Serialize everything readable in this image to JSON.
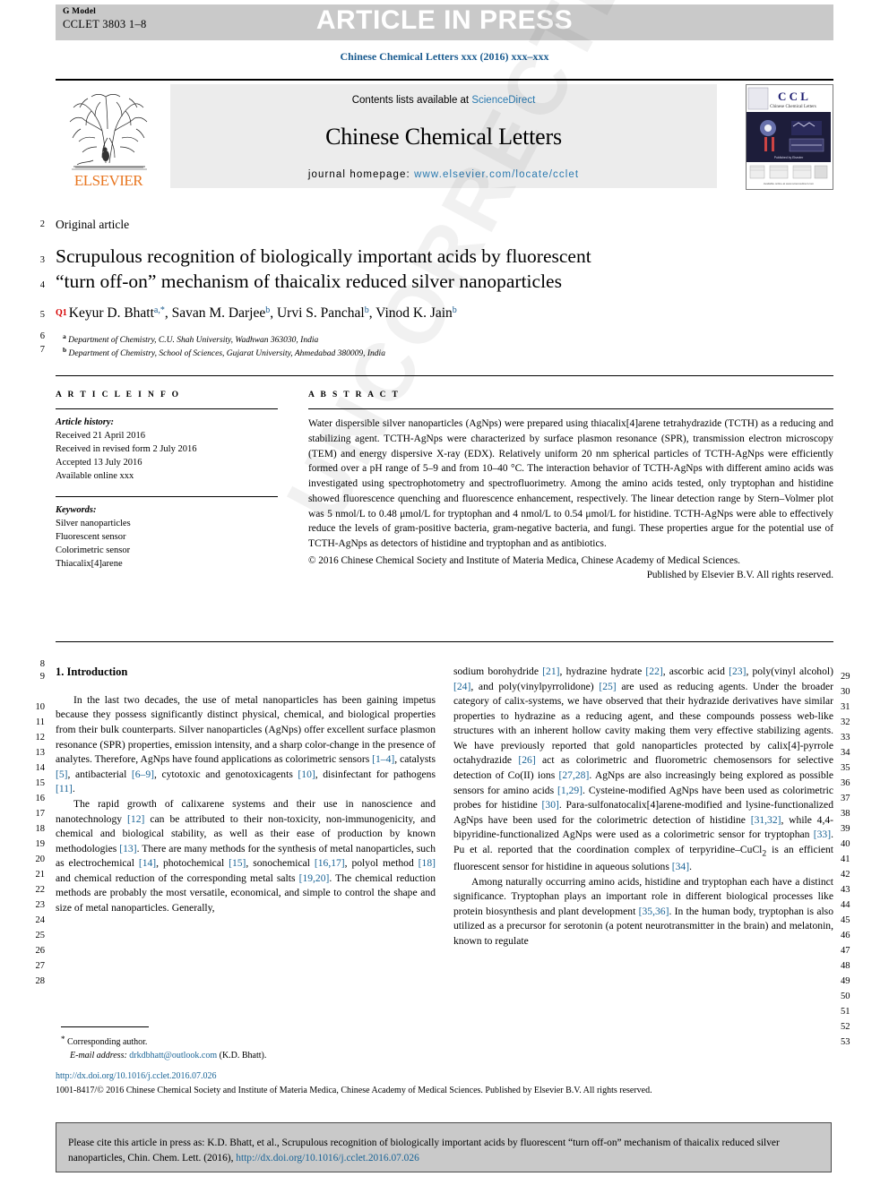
{
  "banner": {
    "g_model_label": "G Model",
    "g_model_code": "CCLET 3803 1–8",
    "article_in_press": "ARTICLE IN PRESS"
  },
  "journal_ref_line": "Chinese Chemical Letters xxx (2016) xxx–xxx",
  "masthead": {
    "contents_prefix": "Contents lists available at ",
    "contents_link": "ScienceDirect",
    "journal_title": "Chinese Chemical Letters",
    "homepage_label": "journal homepage: ",
    "homepage_url": "www.elsevier.com/locate/cclet",
    "publisher": "ELSEVIER",
    "cover_title": "C C L",
    "cover_subtitle": "Chinese Chemical Letters"
  },
  "article": {
    "type_label": "Original article",
    "title_line1": "Scrupulous recognition of biologically important acids by fluorescent",
    "title_line2": "“turn off-on” mechanism of thaicalix reduced silver nanoparticles",
    "query_marker": "Q1",
    "authors_html": "Keyur D. Bhatt, Savan M. Darjee, Urvi S. Panchal, Vinod K. Jain",
    "affiliation_a": "Department of Chemistry, C.U. Shah University, Wadhwan 363030, India",
    "affiliation_b": "Department of Chemistry, School of Sciences, Gujarat University, Ahmedabad 380009, India"
  },
  "article_info": {
    "heading": "A R T I C L E  I N F O",
    "history_label": "Article history:",
    "history": [
      "Received 21 April 2016",
      "Received in revised form 2 July 2016",
      "Accepted 13 July 2016",
      "Available online xxx"
    ],
    "keywords_label": "Keywords:",
    "keywords": [
      "Silver nanoparticles",
      "Fluorescent sensor",
      "Colorimetric sensor",
      "Thiacalix[4]arene"
    ]
  },
  "abstract": {
    "heading": "A B S T R A C T",
    "text": "Water dispersible silver nanoparticles (AgNps) were prepared using thiacalix[4]arene tetrahydrazide (TCTH) as a reducing and stabilizing agent. TCTH-AgNps were characterized by surface plasmon resonance (SPR), transmission electron microscopy (TEM) and energy dispersive X-ray (EDX). Relatively uniform 20 nm spherical particles of TCTH-AgNps were efficiently formed over a pH range of 5–9 and from 10–40 °C. The interaction behavior of TCTH-AgNps with different amino acids was investigated using spectrophotometry and spectrofluorimetry. Among the amino acids tested, only tryptophan and histidine showed fluorescence quenching and fluorescence enhancement, respectively. The linear detection range by Stern–Volmer plot was 5 nmol/L to 0.48 μmol/L for tryptophan and 4 nmol/L to 0.54 μmol/L for histidine. TCTH-AgNps were able to effectively reduce the levels of gram-positive bacteria, gram-negative bacteria, and fungi. These properties argue for the potential use of TCTH-AgNps as detectors of histidine and tryptophan and as antibiotics.",
    "copyright_line1": "© 2016 Chinese Chemical Society and Institute of Materia Medica, Chinese Academy of Medical Sciences.",
    "copyright_line2": "Published by Elsevier B.V. All rights reserved."
  },
  "body": {
    "section_heading": "1. Introduction",
    "left_paragraphs": [
      "In the last two decades, the use of metal nanoparticles has been gaining impetus because they possess significantly distinct physical, chemical, and biological properties from their bulk counterparts. Silver nanoparticles (AgNps) offer excellent surface plasmon resonance (SPR) properties, emission intensity, and a sharp color-change in the presence of analytes. Therefore, AgNps have found applications as colorimetric sensors [1–4], catalysts [5], antibacterial [6–9], cytotoxic and genotoxicagents [10], disinfectant for pathogens [11].",
      "The rapid growth of calixarene systems and their use in nanoscience and nanotechnology [12] can be attributed to their non-toxicity, non-immunogenicity, and chemical and biological stability, as well as their ease of production by known methodologies [13]. There are many methods for the synthesis of metal nanoparticles, such as electrochemical [14], photochemical [15], sonochemical [16,17], polyol method [18] and chemical reduction of the corresponding metal salts [19,20]. The chemical reduction methods are probably the most versatile, economical, and simple to control the shape and size of metal nanoparticles. Generally,"
    ],
    "right_paragraphs": [
      "sodium borohydride [21], hydrazine hydrate [22], ascorbic acid [23], poly(vinyl alcohol) [24], and poly(vinylpyrrolidone) [25] are used as reducing agents. Under the broader category of calix-systems, we have observed that their hydrazide derivatives have similar properties to hydrazine as a reducing agent, and these compounds possess web-like structures with an inherent hollow cavity making them very effective stabilizing agents. We have previously reported that gold nanoparticles protected by calix[4]-pyrrole octahydrazide [26] act as colorimetric and fluorometric chemosensors for selective detection of Co(II) ions [27,28]. AgNps are also increasingly being explored as possible sensors for amino acids [1,29]. Cysteine-modified AgNps have been used as colorimetric probes for histidine [30]. Para-sulfonatocalix[4]arene-modified and lysine-functionalized AgNps have been used for the colorimetric detection of histidine [31,32], while 4,4-bipyridine-functionalized AgNps were used as a colorimetric sensor for tryptophan [33]. Pu et al. reported that the coordination complex of terpyridine–CuCl2 is an efficient fluorescent sensor for histidine in aqueous solutions [34].",
      "Among naturally occurring amino acids, histidine and tryptophan each have a distinct significance. Tryptophan plays an important role in different biological processes like protein biosynthesis and plant development [35,36]. In the human body, tryptophan is also utilized as a precursor for serotonin (a potent neurotransmitter in the brain) and melatonin, known to regulate"
    ]
  },
  "footnotes": {
    "corresponding_author": "Corresponding author.",
    "email_label": "E-mail address:",
    "email": "drkdbhatt@outlook.com",
    "email_owner": "(K.D. Bhatt).",
    "doi": "http://dx.doi.org/10.1016/j.cclet.2016.07.026",
    "copyright": "1001-8417/© 2016 Chinese Chemical Society and Institute of Materia Medica, Chinese Academy of Medical Sciences. Published by Elsevier B.V. All rights reserved."
  },
  "cite_box": {
    "text_part1": "Please cite this article in press as: K.D. Bhatt, et al., Scrupulous recognition of biologically important acids by fluorescent “turn off-on” mechanism of thaicalix reduced silver nanoparticles, Chin. Chem. Lett. (2016), ",
    "link": "http://dx.doi.org/10.1016/j.cclet.2016.07.026"
  },
  "watermark": "UNCORRECTED PROOF",
  "line_numbers": {
    "title_block": [
      "2",
      "3",
      "4",
      "5",
      "6",
      "7"
    ],
    "body_start": [
      "8",
      "9"
    ],
    "left_column": [
      "10",
      "11",
      "12",
      "13",
      "14",
      "15",
      "16",
      "17",
      "18",
      "19",
      "20",
      "21",
      "22",
      "23",
      "24",
      "25",
      "26",
      "27",
      "28"
    ],
    "right_column": [
      "29",
      "30",
      "31",
      "32",
      "33",
      "34",
      "35",
      "36",
      "37",
      "38",
      "39",
      "40",
      "41",
      "42",
      "43",
      "44",
      "45",
      "46",
      "47",
      "48",
      "49",
      "50",
      "51",
      "52",
      "53"
    ]
  },
  "colors": {
    "link_blue": "#1a6496",
    "journal_blue": "#1a5b8f",
    "elsevier_orange": "#E87722",
    "query_red": "#d60000",
    "banner_gray": "#c9c9c9"
  }
}
